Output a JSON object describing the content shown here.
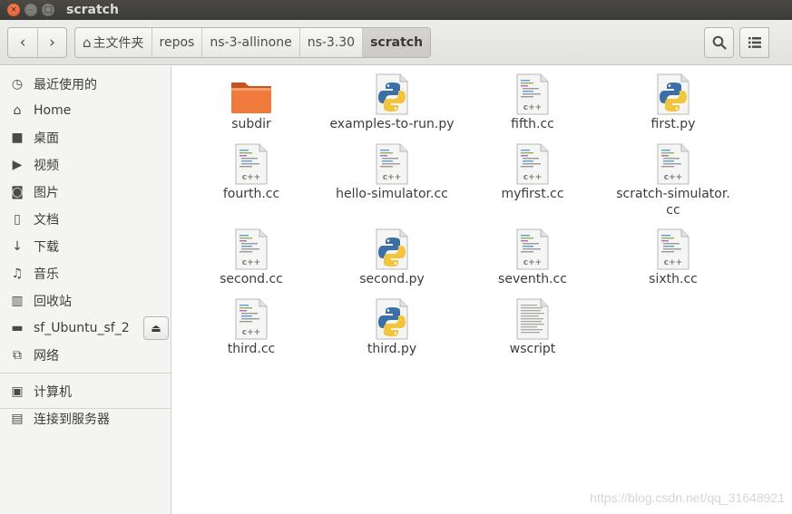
{
  "window": {
    "title": "scratch",
    "close_glyph": "×",
    "min_glyph": "–",
    "max_glyph": "□"
  },
  "toolbar": {
    "back_icon": "chevron-left-icon",
    "forward_icon": "chevron-right-icon",
    "back_glyph": "‹",
    "forward_glyph": "›",
    "home_glyph": "⌂",
    "breadcrumbs": [
      "主文件夹",
      "repos",
      "ns-3-allinone",
      "ns-3.30",
      "scratch"
    ],
    "search_glyph": "⌕",
    "list_glyph": "☰",
    "grid_glyph": "⠿"
  },
  "sidebar": {
    "items": [
      {
        "label": "最近使用的",
        "icon": "clock-icon",
        "glyph": "◷"
      },
      {
        "label": "Home",
        "icon": "home-icon",
        "glyph": "⌂"
      },
      {
        "label": "桌面",
        "icon": "folder-icon",
        "glyph": "■"
      },
      {
        "label": "视频",
        "icon": "video-icon",
        "glyph": "▶"
      },
      {
        "label": "图片",
        "icon": "camera-icon",
        "glyph": "◙"
      },
      {
        "label": "文档",
        "icon": "document-icon",
        "glyph": "▯"
      },
      {
        "label": "下载",
        "icon": "download-icon",
        "glyph": "↓"
      },
      {
        "label": "音乐",
        "icon": "music-icon",
        "glyph": "♫"
      },
      {
        "label": "回收站",
        "icon": "trash-icon",
        "glyph": "▥"
      },
      {
        "label": "sf_Ubuntu_sf_2",
        "icon": "drive-icon",
        "glyph": "▬"
      },
      {
        "label": "网络",
        "icon": "network-icon",
        "glyph": "⧉"
      },
      {
        "label": "计算机",
        "icon": "computer-icon",
        "glyph": "▣"
      },
      {
        "label": "连接到服务器",
        "icon": "server-icon",
        "glyph": "▤"
      }
    ],
    "eject_glyph": "⏏"
  },
  "files": [
    {
      "name": "subdir",
      "type": "folder"
    },
    {
      "name": "examples-to-run.py",
      "type": "python"
    },
    {
      "name": "fifth.cc",
      "type": "cpp"
    },
    {
      "name": "first.py",
      "type": "python"
    },
    {
      "name": "fourth.cc",
      "type": "cpp"
    },
    {
      "name": "hello-simulator.cc",
      "type": "cpp"
    },
    {
      "name": "myfirst.cc",
      "type": "cpp"
    },
    {
      "name": "scratch-simulator.cc",
      "type": "cpp",
      "line1": "scratch-simulator.",
      "line2": "cc"
    },
    {
      "name": "second.cc",
      "type": "cpp"
    },
    {
      "name": "second.py",
      "type": "python"
    },
    {
      "name": "seventh.cc",
      "type": "cpp"
    },
    {
      "name": "sixth.cc",
      "type": "cpp"
    },
    {
      "name": "third.cc",
      "type": "cpp"
    },
    {
      "name": "third.py",
      "type": "python"
    },
    {
      "name": "wscript",
      "type": "text"
    }
  ],
  "file_icon_label": "c++",
  "watermark": "https://blog.csdn.net/qq_31648921",
  "colors": {
    "titlebar": "#3c3b37",
    "close_button": "#e0551f",
    "folder": "#e9692c",
    "python_blue": "#3a6fa8",
    "python_yellow": "#f2c53d"
  }
}
